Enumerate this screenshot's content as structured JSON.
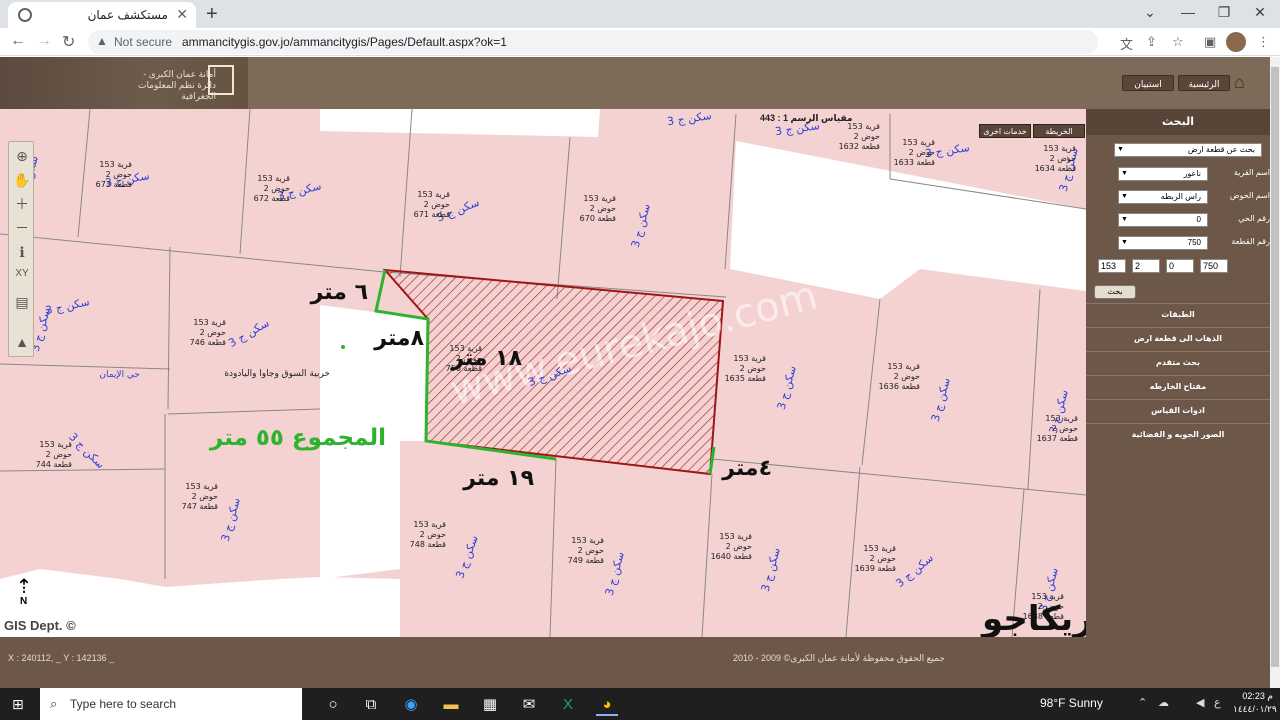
{
  "browser": {
    "tab_title": "مستكشف عمان",
    "url_security": "Not secure",
    "url": "ammancitygis.gov.jo/ammancitygis/Pages/Default.aspx?ok=1"
  },
  "header": {
    "logo_text": "أمانة عمان الكبرى - دائرة نظم المعلومات الجغرافية",
    "buttons": {
      "home": "الرئيسية",
      "survey": "استبيان"
    }
  },
  "map": {
    "scale": "مقياس الرسم 1 : 443",
    "btn_map": "الخريطة",
    "btn_other": "خدمات اخرى",
    "gis_dept": "GIS Dept. ©",
    "north_label": "N",
    "watermark_site": "www.eurekajo.com",
    "watermark_brand": "يوريكاجو",
    "annotations": {
      "side_top": "٦ متر",
      "side_left": "٨متر",
      "side_mid": "١٨ متر",
      "side_bottom": "١٩ متر",
      "side_right": "٤متر",
      "total": "المجموع ٥٥ متر"
    },
    "zone": "سكن ج 3",
    "street": "حي الإيمان",
    "area_name": "خربية السوق وجاوا واليادودة",
    "parcels": [
      {
        "village": "قرية 153",
        "basin": "حوض 2",
        "plot": "قطعة 673"
      },
      {
        "village": "قرية 153",
        "basin": "حوض 2",
        "plot": "قطعة 672"
      },
      {
        "village": "قرية 153",
        "basin": "حوض 2",
        "plot": "قطعة 671"
      },
      {
        "village": "قرية 153",
        "basin": "حوض 2",
        "plot": "قطعة 670"
      },
      {
        "village": "قرية 153",
        "basin": "حوض 2",
        "plot": "قطعة 1632"
      },
      {
        "village": "قرية 153",
        "basin": "حوض 2",
        "plot": "قطعة 1633"
      },
      {
        "village": "قرية 153",
        "basin": "حوض 2",
        "plot": "قطعة 1634"
      },
      {
        "village": "قرية 153",
        "basin": "حوض 2",
        "plot": "قطعة 746"
      },
      {
        "village": "قرية 153",
        "basin": "حوض 2",
        "plot": "قطعة 750"
      },
      {
        "village": "قرية 153",
        "basin": "حوض 2",
        "plot": "قطعة 1635"
      },
      {
        "village": "قرية 153",
        "basin": "حوض 2",
        "plot": "قطعة 1636"
      },
      {
        "village": "قرية 153",
        "basin": "حوض 2",
        "plot": "قطعة 1637"
      },
      {
        "village": "قرية 153",
        "basin": "حوض 2",
        "plot": "قطعة 744"
      },
      {
        "village": "قرية 153",
        "basin": "حوض 2",
        "plot": "قطعة 747"
      },
      {
        "village": "قرية 153",
        "basin": "حوض 2",
        "plot": "قطعة 748"
      },
      {
        "village": "قرية 153",
        "basin": "حوض 2",
        "plot": "قطعة 749"
      },
      {
        "village": "قرية 153",
        "basin": "حوض 2",
        "plot": "قطعة 1640"
      },
      {
        "village": "قرية 153",
        "basin": "حوض 2",
        "plot": "قطعة 1639"
      },
      {
        "village": "قرية 153",
        "basin": "حوض 2",
        "plot": "قطعة 1638"
      }
    ]
  },
  "panel": {
    "title": "البحث",
    "search_type": "بحث عن قطعة ارض",
    "village_label": "اسم القرية",
    "village_value": "ناعور",
    "basin_label": "اسم الحوض",
    "basin_value": "راس الربطه",
    "district_label": "رقم الحي",
    "district_value": "0",
    "plot_label": "رقم القطعة",
    "plot_value": "750",
    "coords": [
      "153",
      "2",
      "0",
      "750"
    ],
    "search_button": "بحث",
    "menu": [
      "الطبقات",
      "الذهاب الى قطعة ارض",
      "بحث متقدم",
      "مفتاح الخارطه",
      "ادوات القياس",
      "الصور الجويه و الفضائية"
    ]
  },
  "footer": {
    "coords": "X : 240112, _ Y : 142136 _",
    "copyright": "جميع الحقوق محفوظة لأمانة عمان الكبرى© 2009 - 2010"
  },
  "taskbar": {
    "search_placeholder": "Type here to search",
    "weather": "98°F  Sunny",
    "time": "02:23 م",
    "date": "١٤٤٤/٠١/٢٩"
  }
}
